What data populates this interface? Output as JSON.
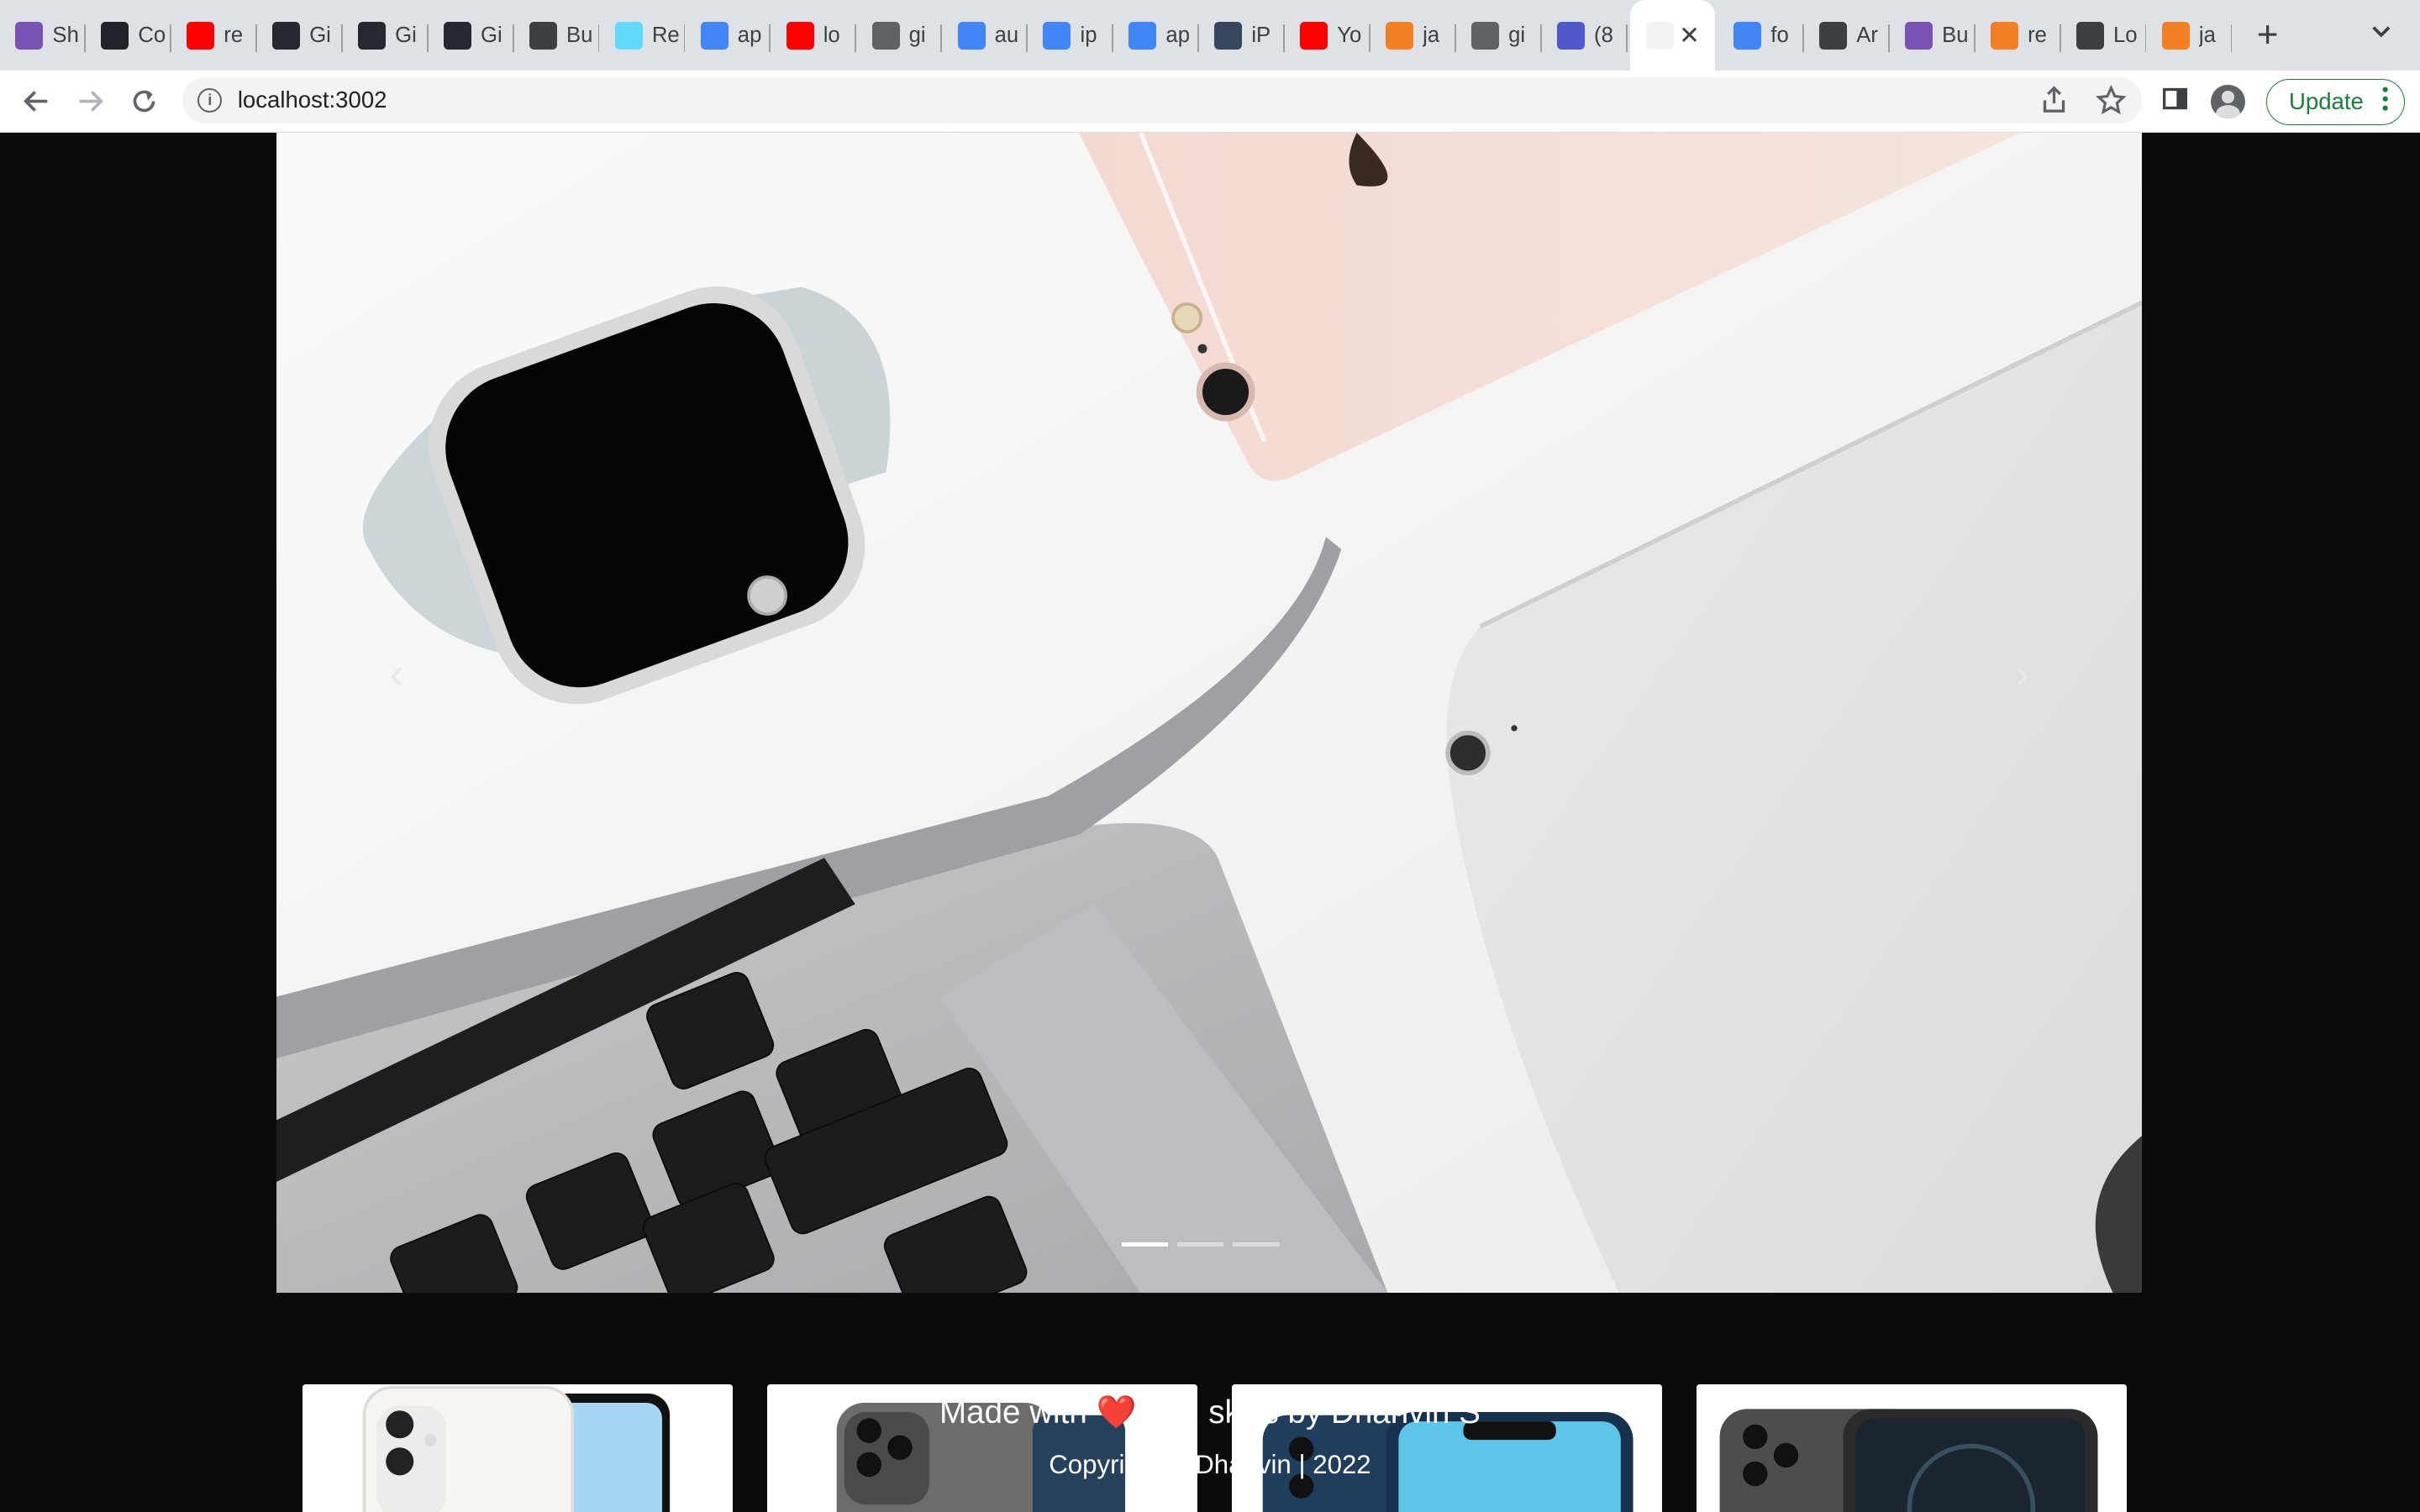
{
  "browser": {
    "tabs": [
      {
        "label": "Sh",
        "icon": "bootstrap-icon",
        "color": "#7952b3"
      },
      {
        "label": "Co",
        "icon": "react-icon",
        "color": "#20232a"
      },
      {
        "label": "re",
        "icon": "youtube-icon",
        "color": "#ff0000"
      },
      {
        "label": "Gi",
        "icon": "github-icon",
        "color": "#24292f"
      },
      {
        "label": "Gi",
        "icon": "github-icon",
        "color": "#24292f"
      },
      {
        "label": "Gi",
        "icon": "github-icon",
        "color": "#24292f"
      },
      {
        "label": "Bu",
        "icon": "code-icon",
        "color": "#3c4043"
      },
      {
        "label": "Re",
        "icon": "react-icon",
        "color": "#61dafb"
      },
      {
        "label": "ap",
        "icon": "google-icon",
        "color": "#4285f4"
      },
      {
        "label": "lo",
        "icon": "youtube-icon",
        "color": "#ff0000"
      },
      {
        "label": "gi",
        "icon": "globe-icon",
        "color": "#5f6368"
      },
      {
        "label": "au",
        "icon": "google-icon",
        "color": "#4285f4"
      },
      {
        "label": "ip",
        "icon": "google-icon",
        "color": "#4285f4"
      },
      {
        "label": "ap",
        "icon": "google-icon",
        "color": "#4285f4"
      },
      {
        "label": "iP",
        "icon": "tumblr-icon",
        "color": "#36465d"
      },
      {
        "label": "Yo",
        "icon": "youtube-icon",
        "color": "#ff0000"
      },
      {
        "label": "ja",
        "icon": "stackoverflow-icon",
        "color": "#f48024"
      },
      {
        "label": "gi",
        "icon": "globe-icon",
        "color": "#5f6368"
      },
      {
        "label": "(8",
        "icon": "teams-icon",
        "color": "#5059c9"
      }
    ],
    "active_tab": {
      "label": "",
      "icon": "blank-icon"
    },
    "tabs_after": [
      {
        "label": "fo",
        "icon": "google-icon",
        "color": "#4285f4"
      },
      {
        "label": "Ar",
        "icon": "mortarboard-icon",
        "color": "#3c4043"
      },
      {
        "label": "Bu",
        "icon": "bootstrap-icon",
        "color": "#7952b3"
      },
      {
        "label": "re",
        "icon": "stackoverflow-icon",
        "color": "#f48024"
      },
      {
        "label": "Lo",
        "icon": "image-icon",
        "color": "#3c4043"
      },
      {
        "label": "ja",
        "icon": "stackoverflow-icon",
        "color": "#f48024"
      }
    ],
    "url": "localhost:3002",
    "update_label": "Update"
  },
  "carousel": {
    "slide_count": 3,
    "active_index": 0
  },
  "footer": {
    "made_with": "Made with ❤️ and skills by Dhanvin S",
    "copyright": "Copyright © Dhanvin | 2022"
  },
  "colors": {
    "page_background": "#0b0b0b",
    "update_green": "#188038"
  }
}
